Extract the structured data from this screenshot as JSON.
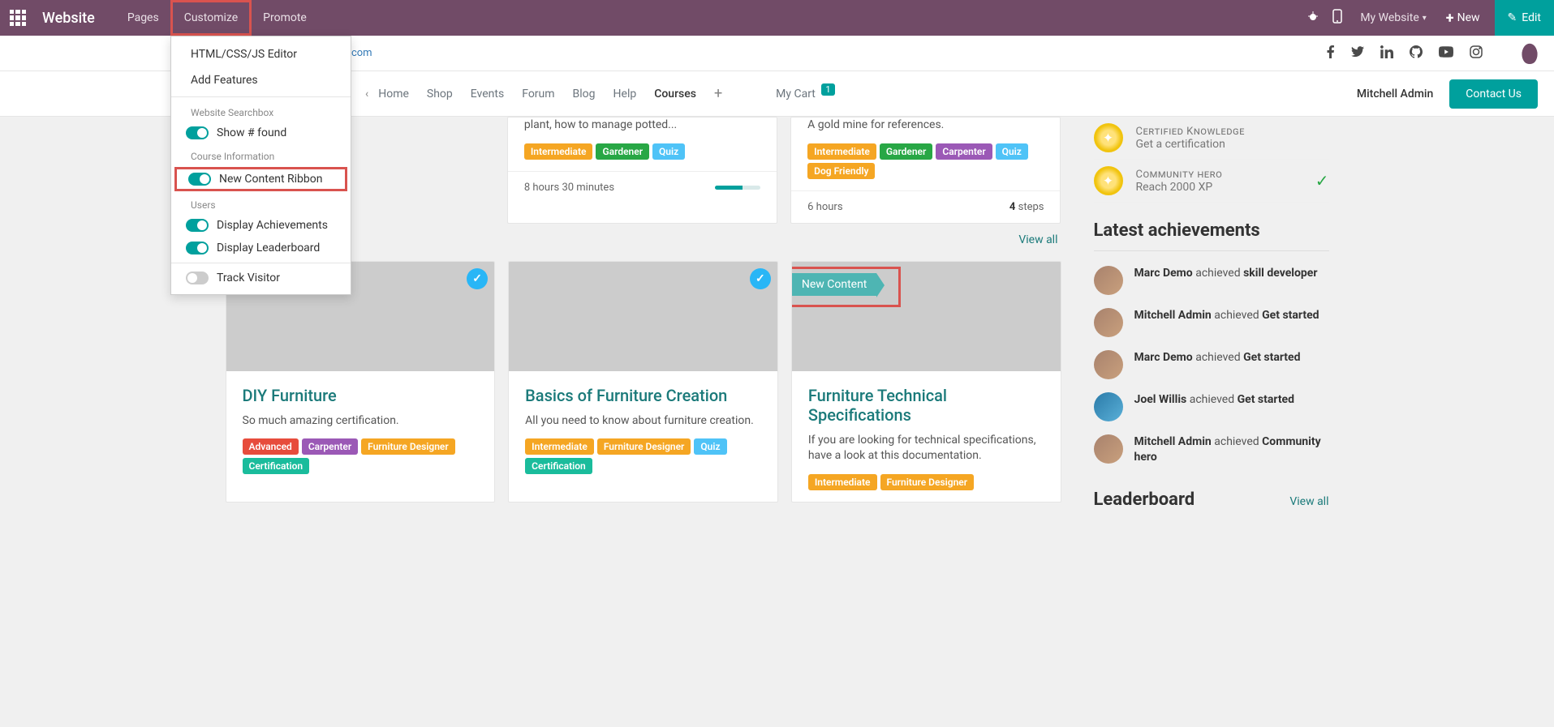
{
  "topbar": {
    "brand": "Website",
    "nav": [
      "Pages",
      "Customize",
      "Promote"
    ],
    "my_website": "My Website",
    "new": "New",
    "edit": "Edit"
  },
  "customize_menu": {
    "item_editor": "HTML/CSS/JS Editor",
    "item_features": "Add Features",
    "section_search": "Website Searchbox",
    "toggle_show_found": "Show # found",
    "section_course": "Course Information",
    "toggle_ribbon": "New Content Ribbon",
    "section_users": "Users",
    "toggle_achievements": "Display Achievements",
    "toggle_leaderboard": "Display Leaderboard",
    "toggle_track": "Track Visitor"
  },
  "subheader": {
    "email_partial": "rcompany.example.com"
  },
  "sitenav": {
    "links": [
      "Home",
      "Shop",
      "Events",
      "Forum",
      "Blog",
      "Help",
      "Courses"
    ],
    "cart": "My Cart",
    "cart_count": "1",
    "admin": "Mitchell Admin",
    "contact": "Contact Us"
  },
  "top_cards": {
    "card1": {
      "desc_partial": "plant, how to manage potted...",
      "tags": [
        "Intermediate",
        "Gardener",
        "Quiz"
      ],
      "duration": "8 hours 30 minutes"
    },
    "card2": {
      "desc_partial": "A gold mine for references.",
      "tags": [
        "Intermediate",
        "Gardener",
        "Carpenter",
        "Quiz",
        "Dog Friendly"
      ],
      "duration": "6 hours",
      "steps_num": "4",
      "steps_label": "steps"
    }
  },
  "view_all": "View all",
  "cards": {
    "diy": {
      "title": "DIY Furniture",
      "desc": "So much amazing certification.",
      "tags": [
        "Advanced",
        "Carpenter",
        "Furniture Designer",
        "Certification"
      ]
    },
    "basics": {
      "title": "Basics of Furniture Creation",
      "desc": "All you need to know about furniture creation.",
      "tags": [
        "Intermediate",
        "Furniture Designer",
        "Quiz",
        "Certification"
      ]
    },
    "specs": {
      "title": "Furniture Technical Specifications",
      "desc": "If you are looking for technical specifications, have a look at this documentation.",
      "tags": [
        "Intermediate",
        "Furniture Designer"
      ],
      "ribbon": "New Content"
    }
  },
  "sidebar": {
    "knowledge_title": "Certified Knowledge",
    "knowledge_sub": "Get a certification",
    "hero_title": "Community hero",
    "hero_sub": "Reach 2000 XP",
    "achievements_heading": "Latest achievements",
    "achievements": [
      {
        "user": "Marc Demo",
        "verb": "achieved",
        "badge": "skill developer"
      },
      {
        "user": "Mitchell Admin",
        "verb": "achieved",
        "badge": "Get started"
      },
      {
        "user": "Marc Demo",
        "verb": "achieved",
        "badge": "Get started"
      },
      {
        "user": "Joel Willis",
        "verb": "achieved",
        "badge": "Get started"
      },
      {
        "user": "Mitchell Admin",
        "verb": "achieved",
        "badge": "Community hero"
      }
    ],
    "leaderboard_heading": "Leaderboard",
    "leaderboard_viewall": "View all"
  }
}
